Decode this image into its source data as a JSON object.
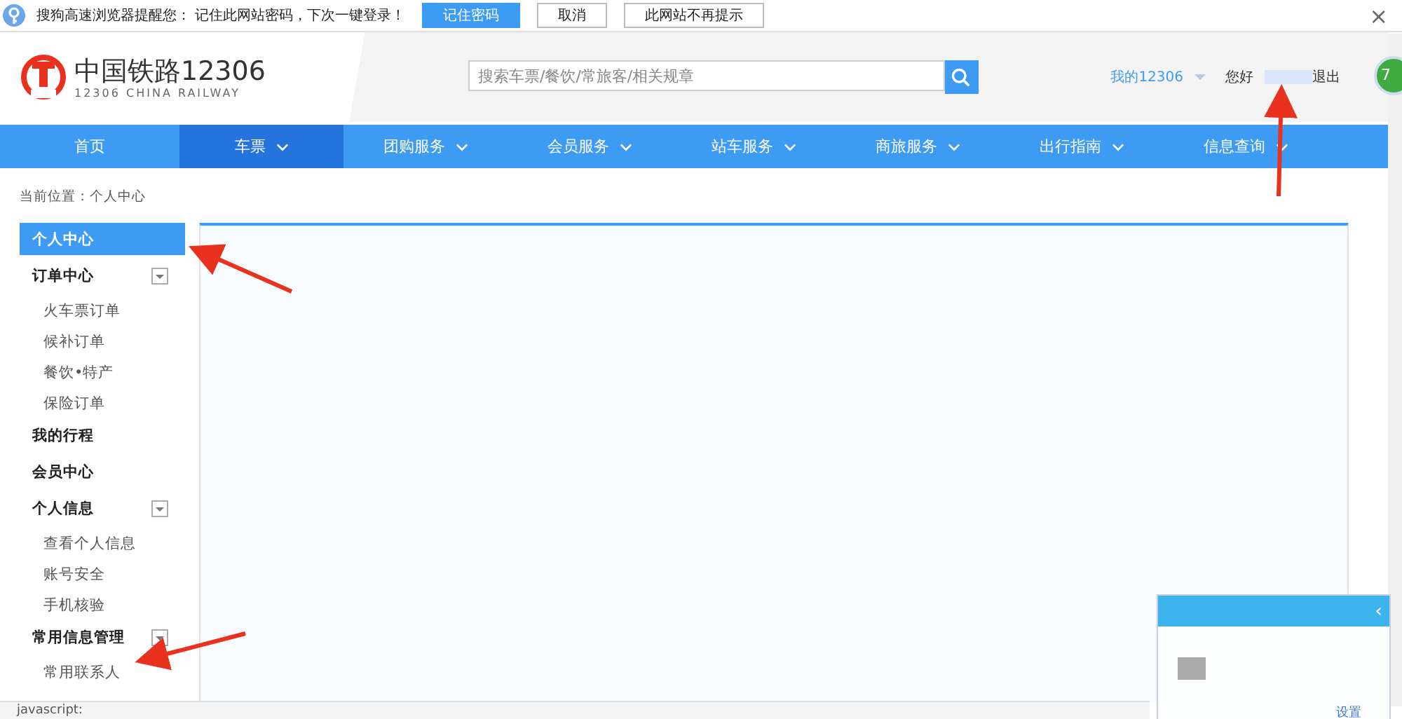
{
  "password_prompt": {
    "message": "搜狗高速浏览器提醒您：  记住此网站密码，下次一键登录！",
    "buttons": [
      {
        "label": "记住密码",
        "kind": "primary"
      },
      {
        "label": "取消",
        "kind": "plain"
      },
      {
        "label": "此网站不再提示",
        "kind": "plain"
      }
    ],
    "close": "×"
  },
  "header": {
    "logo_title": "中国铁路12306",
    "logo_subtitle": "12306 CHINA RAILWAY",
    "search": {
      "placeholder": "搜索车票/餐饮/常旅客/相关规章"
    },
    "my_account": "我的12306",
    "greeting": "您好",
    "logout": "退出"
  },
  "nav": [
    {
      "label": "首页",
      "dropdown": false,
      "selected": false
    },
    {
      "label": "车票",
      "dropdown": true,
      "selected": true
    },
    {
      "label": "团购服务",
      "dropdown": true,
      "selected": false
    },
    {
      "label": "会员服务",
      "dropdown": true,
      "selected": false
    },
    {
      "label": "站车服务",
      "dropdown": true,
      "selected": false
    },
    {
      "label": "商旅服务",
      "dropdown": true,
      "selected": false
    },
    {
      "label": "出行指南",
      "dropdown": true,
      "selected": false
    },
    {
      "label": "信息查询",
      "dropdown": true,
      "selected": false
    }
  ],
  "breadcrumb": "当前位置：个人中心",
  "sidebar": [
    {
      "label": "个人中心",
      "selected": true,
      "expanded": false
    },
    {
      "label": "订单中心",
      "selected": false,
      "expanded": true,
      "children": [
        {
          "label": "火车票订单"
        },
        {
          "label": "候补订单"
        },
        {
          "label": "餐饮•特产"
        },
        {
          "label": "保险订单"
        }
      ]
    },
    {
      "label": "我的行程",
      "selected": false,
      "expanded": false
    },
    {
      "label": "会员中心",
      "selected": false,
      "expanded": false
    },
    {
      "label": "个人信息",
      "selected": false,
      "expanded": true,
      "children": [
        {
          "label": "查看个人信息"
        },
        {
          "label": "账号安全"
        },
        {
          "label": "手机核验"
        }
      ]
    },
    {
      "label": "常用信息管理",
      "selected": false,
      "expanded": true,
      "children": [
        {
          "label": "常用联系人"
        }
      ]
    }
  ],
  "side_badge": "7",
  "popup": {
    "close": "‹",
    "link": "设置"
  },
  "status_bar": {
    "text": "javascript:"
  }
}
